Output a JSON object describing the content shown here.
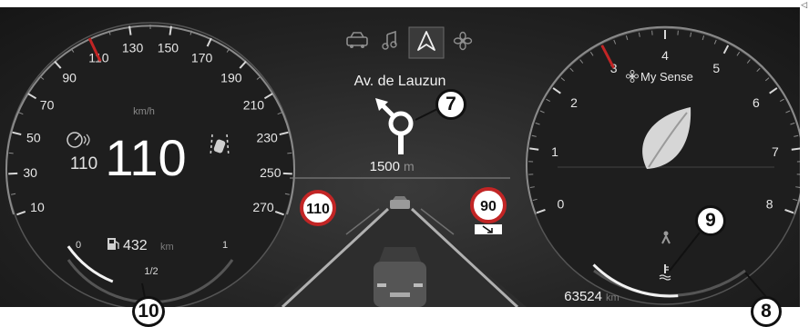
{
  "nav_tabs": [
    {
      "icon": "car-icon",
      "active": false
    },
    {
      "icon": "music-note-icon",
      "active": false
    },
    {
      "icon": "navigation-arrow-icon",
      "active": true
    },
    {
      "icon": "fan-icon",
      "active": false
    }
  ],
  "speedometer": {
    "unit": "km/h",
    "speed": "110",
    "cruise_set_speed": "110",
    "ticks": [
      "10",
      "30",
      "50",
      "70",
      "90",
      "110",
      "130",
      "150",
      "170",
      "190",
      "210",
      "230",
      "250",
      "270"
    ]
  },
  "fuel": {
    "range_value": "432",
    "range_unit": "km",
    "empty_label": "0",
    "half_label": "1/2",
    "full_label": "1",
    "level": 0.3
  },
  "navigation": {
    "street": "Av. de Lauzun",
    "distance_value": "1500",
    "distance_unit": "m"
  },
  "speed_signs": {
    "current_limit": "110",
    "upcoming_limit": "90"
  },
  "tachometer": {
    "ticks": [
      "0",
      "1",
      "2",
      "3",
      "4",
      "5",
      "6",
      "7",
      "8"
    ],
    "mode_label": "My Sense",
    "coolant_level": 0.55
  },
  "odometer": {
    "value": "63524",
    "unit": "km"
  },
  "callouts": [
    "7",
    "8",
    "9",
    "10"
  ],
  "colors": {
    "accent_red": "#c22525",
    "gauge_white": "#e8e8e8",
    "callout_bg": "#ffffff"
  }
}
